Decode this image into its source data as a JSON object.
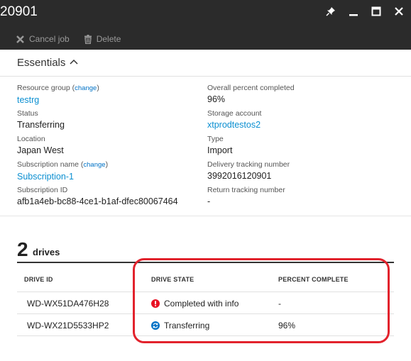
{
  "window": {
    "title": "20901"
  },
  "toolbar": {
    "cancel_label": "Cancel job",
    "delete_label": "Delete"
  },
  "essentials": {
    "title": "Essentials",
    "resource_group": {
      "label": "Resource group",
      "change": "change",
      "value": "testrg"
    },
    "status": {
      "label": "Status",
      "value": "Transferring"
    },
    "location": {
      "label": "Location",
      "value": "Japan West"
    },
    "subscription_name": {
      "label": "Subscription name",
      "change": "change",
      "value": "Subscription-1"
    },
    "subscription_id": {
      "label": "Subscription ID",
      "value": "afb1a4eb-bc88-4ce1-b1af-dfec80067464"
    },
    "overall_percent": {
      "label": "Overall percent completed",
      "value": "96%"
    },
    "storage_account": {
      "label": "Storage account",
      "value": "xtprodtestos2"
    },
    "type": {
      "label": "Type",
      "value": "Import"
    },
    "delivery_tracking": {
      "label": "Delivery tracking number",
      "value": "3992016120901"
    },
    "return_tracking": {
      "label": "Return tracking number",
      "value": "-"
    }
  },
  "drives": {
    "count": "2",
    "label": "drives",
    "columns": [
      "DRIVE ID",
      "DRIVE STATE",
      "PERCENT COMPLETE"
    ],
    "rows": [
      {
        "drive_id": "WD-WX51DA476H28",
        "state": "Completed with info",
        "state_icon": "error-icon",
        "state_color": "#e81123",
        "percent": "-"
      },
      {
        "drive_id": "WD-WX21D5533HP2",
        "state": "Transferring",
        "state_icon": "sync-icon",
        "state_color": "#0072c6",
        "percent": "96%"
      }
    ]
  },
  "colors": {
    "titlebar": "#2b2b2b",
    "link": "#0b8fd1",
    "highlight": "#e2222c"
  }
}
